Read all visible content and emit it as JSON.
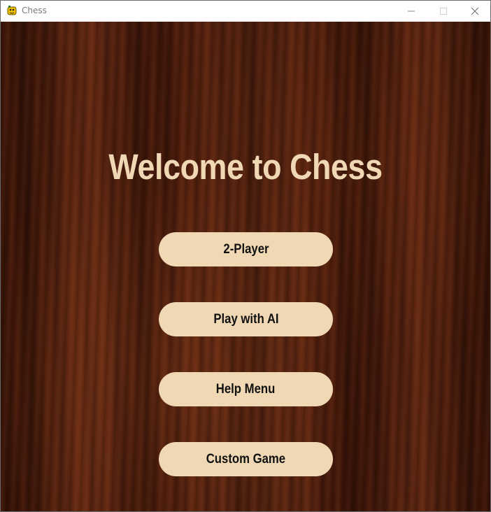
{
  "window": {
    "title": "Chess",
    "icon": "pygame-snake-icon",
    "controls": {
      "minimize": "minimize-icon",
      "maximize": "maximize-icon",
      "close": "close-icon"
    }
  },
  "main": {
    "heading": "Welcome to Chess",
    "buttons": [
      {
        "label": "2-Player"
      },
      {
        "label": "Play with AI"
      },
      {
        "label": "Help Menu"
      },
      {
        "label": "Custom Game"
      }
    ]
  },
  "colors": {
    "button_fill": "#f0d8b5",
    "button_text": "#111111",
    "heading": "#f0d8b5",
    "background_wood": "#4a1c0c"
  }
}
